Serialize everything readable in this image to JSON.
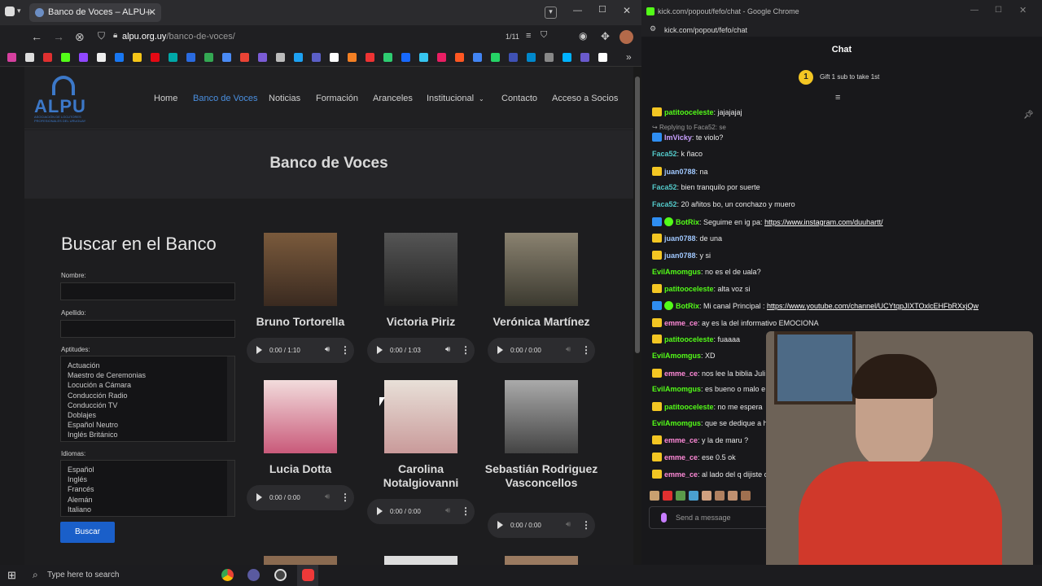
{
  "left_browser": {
    "tab_title": "Banco de Voces – ALPU",
    "address_domain": "alpu.org.uy",
    "address_path": "/banco-de-voces/",
    "page_counter": "1/11"
  },
  "site": {
    "logo_text": "ALPU",
    "logo_subtext": "ASOCIACIÓN DE LOCUTORES PROFESIONALES DEL URUGUAY",
    "nav": [
      "Home",
      "Banco de Voces",
      "Noticias",
      "Formación",
      "Aranceles",
      "Institucional",
      "Contacto",
      "Acceso a Socios"
    ],
    "hero_title": "Banco de Voces",
    "search": {
      "title": "Buscar en el Banco",
      "nombre_label": "Nombre:",
      "apellido_label": "Apellido:",
      "aptitudes_label": "Aptitudes:",
      "aptitudes": [
        "Actuación",
        "Maestro de Ceremonias",
        "Locución a Cámara",
        "Conducción Radio",
        "Conducción TV",
        "Doblajes",
        "Español Neutro",
        "Inglés Británico"
      ],
      "idiomas_label": "Idiomas:",
      "idiomas": [
        "Español",
        "Inglés",
        "Francés",
        "Alemán",
        "Italiano"
      ],
      "button": "Buscar"
    },
    "voices": [
      {
        "name": "Bruno Tortorella",
        "time": "0:00 / 1:10"
      },
      {
        "name": "Victoria Piriz",
        "time": "0:00 / 1:03"
      },
      {
        "name": "Verónica Martínez",
        "time": "0:00 / 0:00"
      },
      {
        "name": "Lucia Dotta",
        "time": "0:00 / 0:00"
      },
      {
        "name": "Carolina Notalgiovanni",
        "time": "0:00 / 0:00"
      },
      {
        "name": "Sebastián Rodriguez Vasconcellos",
        "time": "0:00 / 0:00"
      }
    ]
  },
  "right_window": {
    "title": "kick.com/popout/fefo/chat - Google Chrome",
    "url": "kick.com/popout/fefo/chat",
    "chat_header": "Chat",
    "gift_text": "Gift 1 sub to take 1st",
    "gift_rank": "1",
    "reply_text": "Replying to Faca52: se",
    "send_placeholder": "Send a message",
    "messages": [
      {
        "user": "patitooceleste",
        "text": ": jajajajaj",
        "badge": "crown",
        "color": "#53fc18"
      },
      {
        "user": "ImVicky",
        "text": ": te violo?",
        "badge": "kick",
        "color": "#c9a0ff"
      },
      {
        "user": "Faca52",
        "text": ": k ñaco",
        "badge": "",
        "color": "#53c9c9"
      },
      {
        "user": "juan0788",
        "text": ": na",
        "badge": "crown",
        "color": "#a0c8ff"
      },
      {
        "user": "Faca52",
        "text": ": bien tranquilo por suerte",
        "badge": "",
        "color": "#53c9c9"
      },
      {
        "user": "Faca52",
        "text": ": 20 añitos bo, un conchazo y muero",
        "badge": "",
        "color": "#53c9c9"
      },
      {
        "user": "BotRix",
        "text": ": Seguime en ig pa: ",
        "link": "https://www.instagram.com/duuhartt/",
        "badge": "bot",
        "color": "#53fc18"
      },
      {
        "user": "juan0788",
        "text": ": de una",
        "badge": "crown",
        "color": "#a0c8ff"
      },
      {
        "user": "juan0788",
        "text": ": y si",
        "badge": "crown",
        "color": "#a0c8ff"
      },
      {
        "user": "EvilAmomgus",
        "text": ": no es el de uala?",
        "badge": "",
        "color": "#53fc18"
      },
      {
        "user": "patitooceleste",
        "text": ": alta voz si",
        "badge": "crown",
        "color": "#53fc18"
      },
      {
        "user": "BotRix",
        "text": ": Mi canal Principal : ",
        "link": "https://www.youtube.com/channel/UCYtqpJIXTOxlcEHFbRXxjQw",
        "badge": "bot",
        "color": "#53fc18"
      },
      {
        "user": "emme_ce",
        "text": ": ay es la del informativo EMOCIONA",
        "badge": "crown",
        "color": "#ff8ad8"
      },
      {
        "user": "patitooceleste",
        "text": ": fuaaaa",
        "badge": "crown",
        "color": "#53fc18"
      },
      {
        "user": "EvilAmomgus",
        "text": ": XD",
        "badge": "",
        "color": "#53fc18"
      },
      {
        "user": "emme_ce",
        "text": ": nos lee la biblia Juli",
        "badge": "crown",
        "color": "#ff8ad8"
      },
      {
        "user": "EvilAmomgus",
        "text": ": es bueno o malo e",
        "badge": "",
        "color": "#53fc18"
      },
      {
        "user": "patitooceleste",
        "text": ": no me espera",
        "badge": "crown",
        "color": "#53fc18"
      },
      {
        "user": "EvilAmomgus",
        "text": ": que se dedique a h",
        "badge": "",
        "color": "#53fc18"
      },
      {
        "user": "emme_ce",
        "text": ": y la de maru ?",
        "badge": "crown",
        "color": "#ff8ad8"
      },
      {
        "user": "emme_ce",
        "text": ": ese 0.5 ok",
        "badge": "crown",
        "color": "#ff8ad8"
      },
      {
        "user": "emme_ce",
        "text": ": al lado del q dijiste c",
        "badge": "crown",
        "color": "#ff8ad8"
      }
    ]
  },
  "taskbar": {
    "search_placeholder": "Type here to search"
  }
}
